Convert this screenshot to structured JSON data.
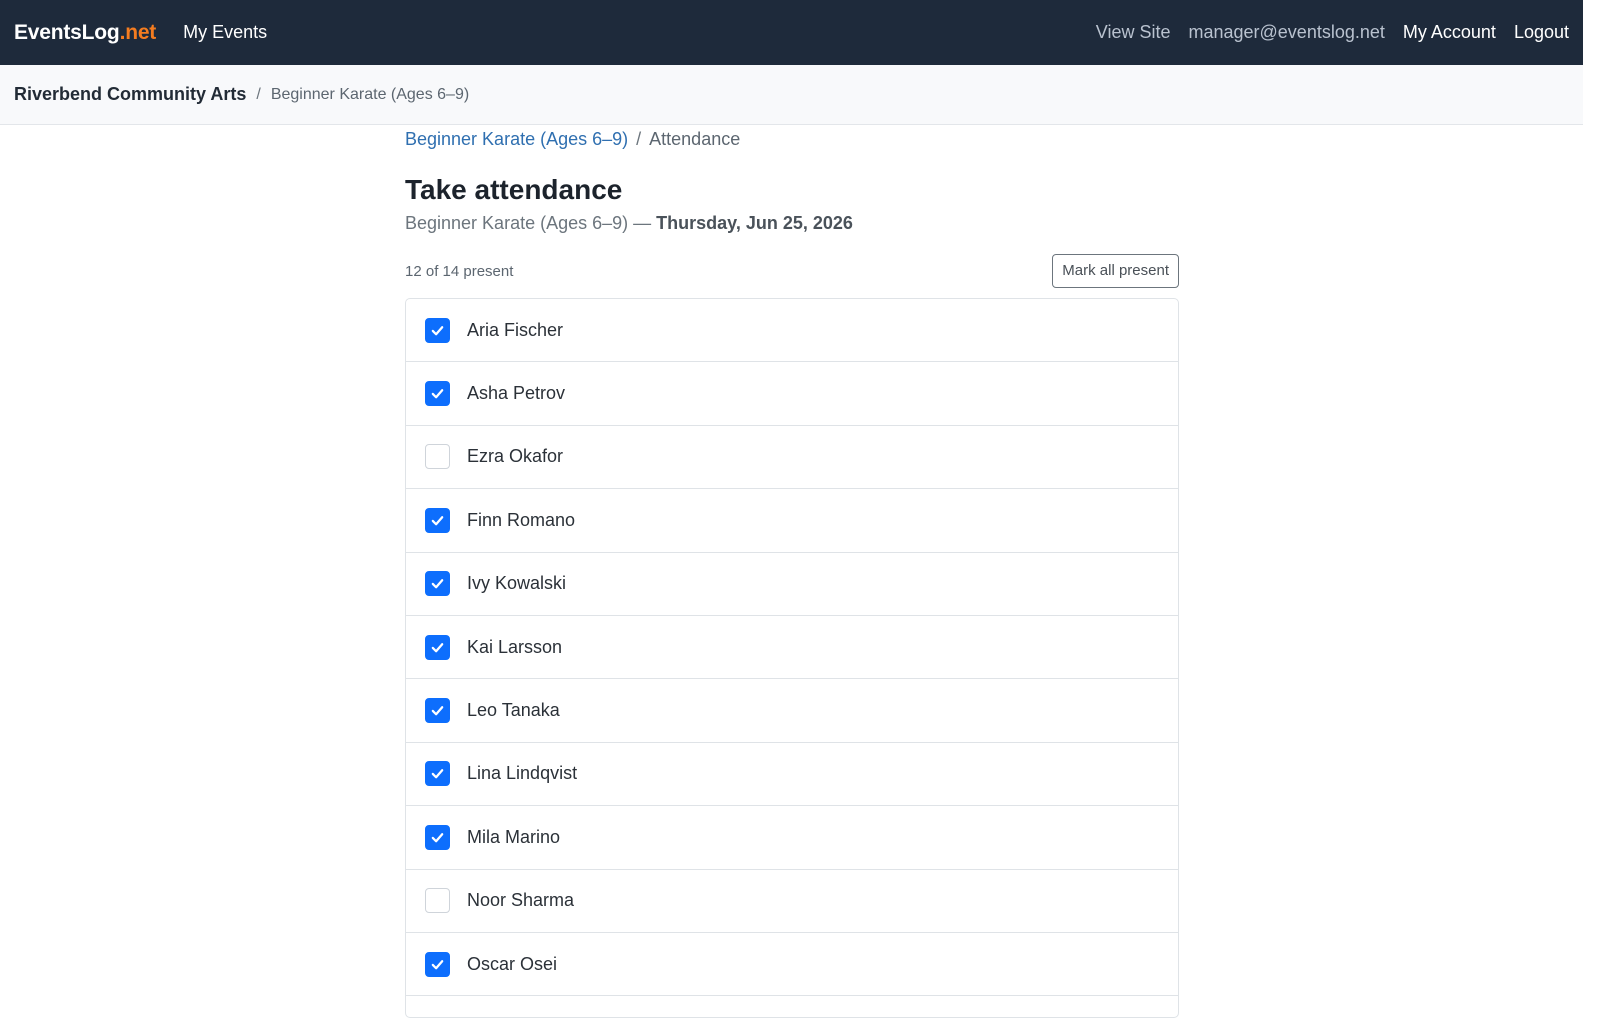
{
  "topnav": {
    "brand_main": "EventsLog",
    "brand_accent": ".net",
    "my_events": "My Events",
    "view_site": "View Site",
    "user_email": "manager@eventslog.net",
    "my_account": "My Account",
    "logout": "Logout"
  },
  "subbar": {
    "org": "Riverbend Community Arts",
    "separator": "/",
    "event": "Beginner Karate (Ages 6–9)"
  },
  "breadcrumb": {
    "parent": "Beginner Karate (Ages 6–9)",
    "separator": "/",
    "current": "Attendance"
  },
  "page": {
    "title": "Take attendance",
    "event_name": "Beginner Karate (Ages 6–9) —",
    "date": "Thursday, Jun 25, 2026"
  },
  "toolbar": {
    "count": "12 of 14 present",
    "mark_all_label": "Mark all present"
  },
  "colors": {
    "nav_bg": "#1e2a3b",
    "brand_accent": "#f47c20",
    "checkbox_checked": "#0d6efd",
    "link": "#2f6fb0"
  },
  "attendees": [
    {
      "name": "Aria Fischer",
      "present": true
    },
    {
      "name": "Asha Petrov",
      "present": true
    },
    {
      "name": "Ezra Okafor",
      "present": false
    },
    {
      "name": "Finn Romano",
      "present": true
    },
    {
      "name": "Ivy Kowalski",
      "present": true
    },
    {
      "name": "Kai Larsson",
      "present": true
    },
    {
      "name": "Leo Tanaka",
      "present": true
    },
    {
      "name": "Lina Lindqvist",
      "present": true
    },
    {
      "name": "Mila Marino",
      "present": true
    },
    {
      "name": "Noor Sharma",
      "present": false
    },
    {
      "name": "Oscar Osei",
      "present": true
    }
  ]
}
